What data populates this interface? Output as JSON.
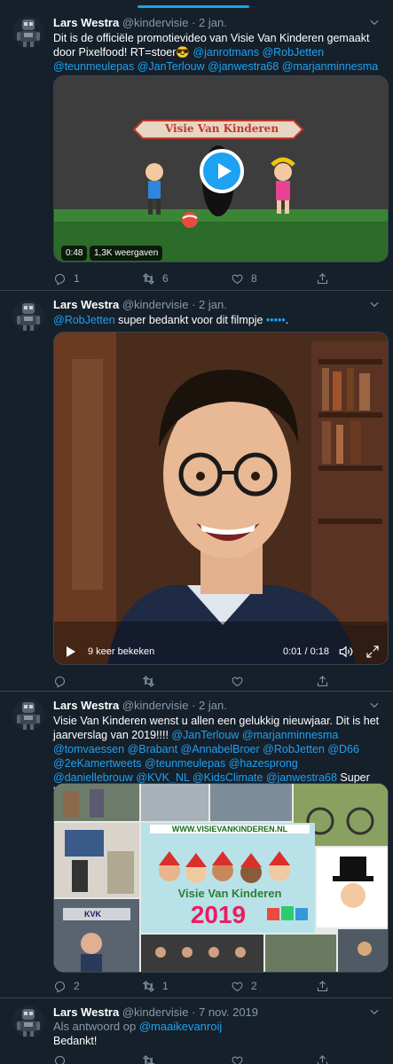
{
  "tweets": [
    {
      "author": "Lars Westra",
      "handle": "@kindervisie",
      "date": "2 jan.",
      "text_plain": "Dit is de officiële promotievideo van Visie Van Kinderen gemaakt door Pixelfood! RT=stoer😎 ",
      "mentions": [
        "@janrotmans",
        "@RobJetten",
        "@teunmeulepas",
        "@JanTerlouw",
        "@janwestra68",
        "@marjanminnesma"
      ],
      "video": {
        "banner": "Visie Van Kinderen",
        "duration": "0:48",
        "views": "1,3K weergaven"
      },
      "replies": "1",
      "retweets": "6",
      "likes": "8"
    },
    {
      "author": "Lars Westra",
      "handle": "@kindervisie",
      "date": "2 jan.",
      "mention": "@RobJetten",
      "text": " super bedankt voor dit filmpje ",
      "sparkles": "•••••",
      "text_end": ".",
      "video": {
        "views": "9 keer bekeken",
        "time": "0:01 / 0:18"
      },
      "replies": "",
      "retweets": "",
      "likes": ""
    },
    {
      "author": "Lars Westra",
      "handle": "@kindervisie",
      "date": "2 jan.",
      "text_plain": "Visie Van Kinderen wenst u allen een gelukkig nieuwjaar. Dit is het jaarverslag van 2019!!!! ",
      "mentions": [
        "@JanTerlouw",
        "@marjanminnesma",
        "@tomvaessen",
        "@Brabant",
        "@AnnabelBroer",
        "@RobJetten",
        "@D66",
        "@2eKamertweets",
        "@teunmeulepas",
        "@hazesprong",
        "@daniellebrouw",
        "@KVK_NL",
        "@KidsClimate",
        "@janwestra68"
      ],
      "text_end": "Super bedankt!!",
      "image": {
        "url": "WWW.VISIEVANKINDEREN.NL",
        "title": "Visie Van Kinderen",
        "year": "2019",
        "kvk": "KVK"
      },
      "replies": "2",
      "retweets": "1",
      "likes": "2"
    },
    {
      "author": "Lars Westra",
      "handle": "@kindervisie",
      "date": "7 nov. 2019",
      "reply_prefix": "Als antwoord op ",
      "reply_to": "@maaikevanroij",
      "text": "Bedankt!",
      "replies": "",
      "retweets": "",
      "likes": ""
    }
  ],
  "colors": {
    "background": "#15202b",
    "accent": "#1da1f2",
    "muted": "#8899a6",
    "divider": "#38444d"
  },
  "icons": [
    "avatar-robot-icon",
    "chevron-down-icon",
    "reply-icon",
    "retweet-icon",
    "like-icon",
    "share-icon",
    "play-icon",
    "volume-icon",
    "fullscreen-icon"
  ]
}
